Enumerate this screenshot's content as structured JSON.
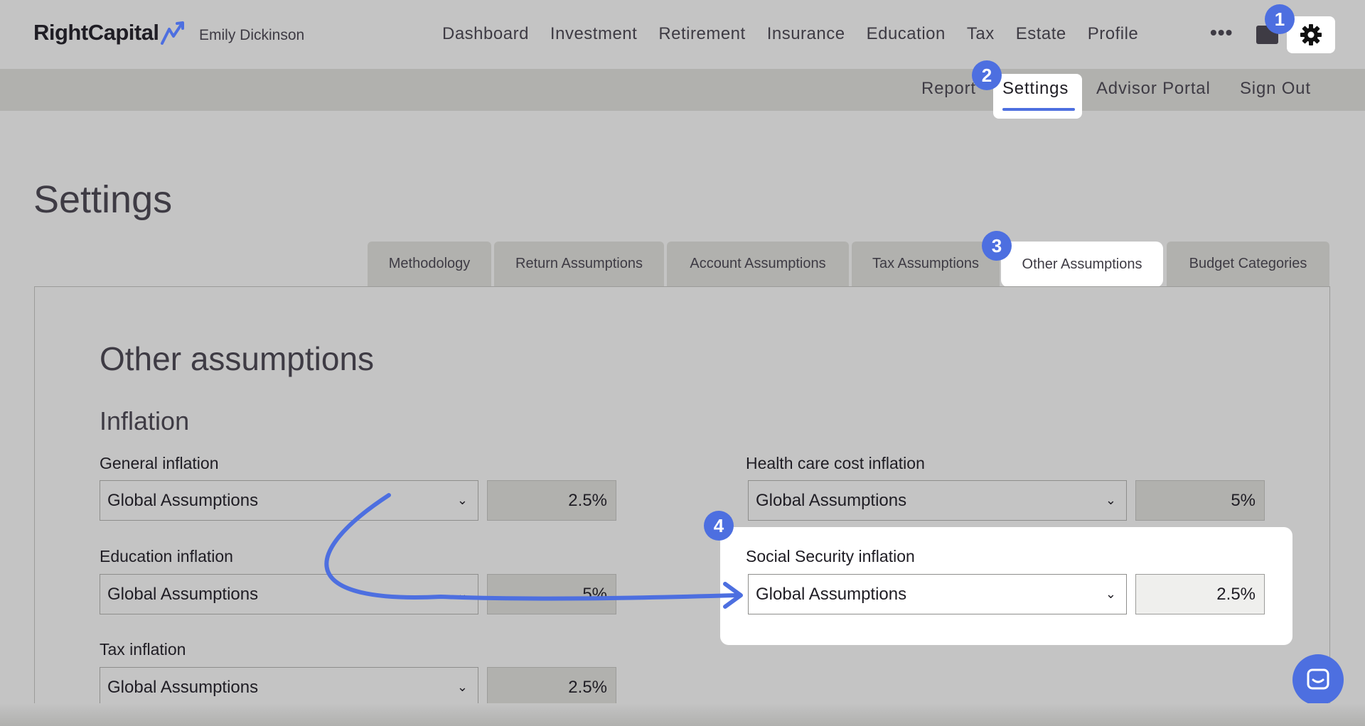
{
  "brand": {
    "name": "RightCapital",
    "client": "Emily Dickinson"
  },
  "main_nav": [
    "Dashboard",
    "Investment",
    "Retirement",
    "Insurance",
    "Education",
    "Tax",
    "Estate",
    "Profile"
  ],
  "more_label": "•••",
  "sub_nav": {
    "report": "Report",
    "settings": "Settings",
    "advisor_portal": "Advisor Portal",
    "sign_out": "Sign Out"
  },
  "page_title": "Settings",
  "tabs": [
    "Methodology",
    "Return Assumptions",
    "Account Assumptions",
    "Tax Assumptions",
    "Other Assumptions",
    "Budget Categories"
  ],
  "active_tab": "Other Assumptions",
  "section": {
    "title": "Other assumptions",
    "subtitle": "Inflation"
  },
  "fields": {
    "general": {
      "label": "General inflation",
      "select": "Global Assumptions",
      "value": "2.5%"
    },
    "education": {
      "label": "Education inflation",
      "select": "Global Assumptions",
      "value": "5%"
    },
    "tax": {
      "label": "Tax inflation",
      "select": "Global Assumptions",
      "value": "2.5%"
    },
    "health": {
      "label": "Health care cost inflation",
      "select": "Global Assumptions",
      "value": "5%"
    },
    "social_security": {
      "label": "Social Security inflation",
      "select": "Global Assumptions",
      "value": "2.5%"
    }
  },
  "badges": [
    "1",
    "2",
    "3",
    "4"
  ],
  "colors": {
    "accent": "#4d6fe0",
    "background_dim": "#c4c4c4",
    "text": "#3e3b44"
  }
}
